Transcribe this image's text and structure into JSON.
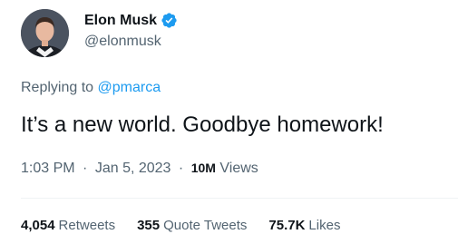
{
  "author": {
    "display_name": "Elon Musk",
    "handle": "@elonmusk",
    "verified": true,
    "verified_color": "#1d9bf0"
  },
  "reply": {
    "prefix": "Replying to",
    "to": "@pmarca"
  },
  "tweet": {
    "text": "It’s a new world. Goodbye homework!"
  },
  "meta": {
    "time": "1:03 PM",
    "separator": "·",
    "date": "Jan 5, 2023",
    "views_count": "10M",
    "views_label": "Views"
  },
  "stats": {
    "retweets_count": "4,054",
    "retweets_label": "Retweets",
    "quotes_count": "355",
    "quotes_label": "Quote Tweets",
    "likes_count": "75.7K",
    "likes_label": "Likes"
  },
  "colors": {
    "accent": "#1d9bf0",
    "secondary_text": "#536471",
    "primary_text": "#0f1419"
  }
}
